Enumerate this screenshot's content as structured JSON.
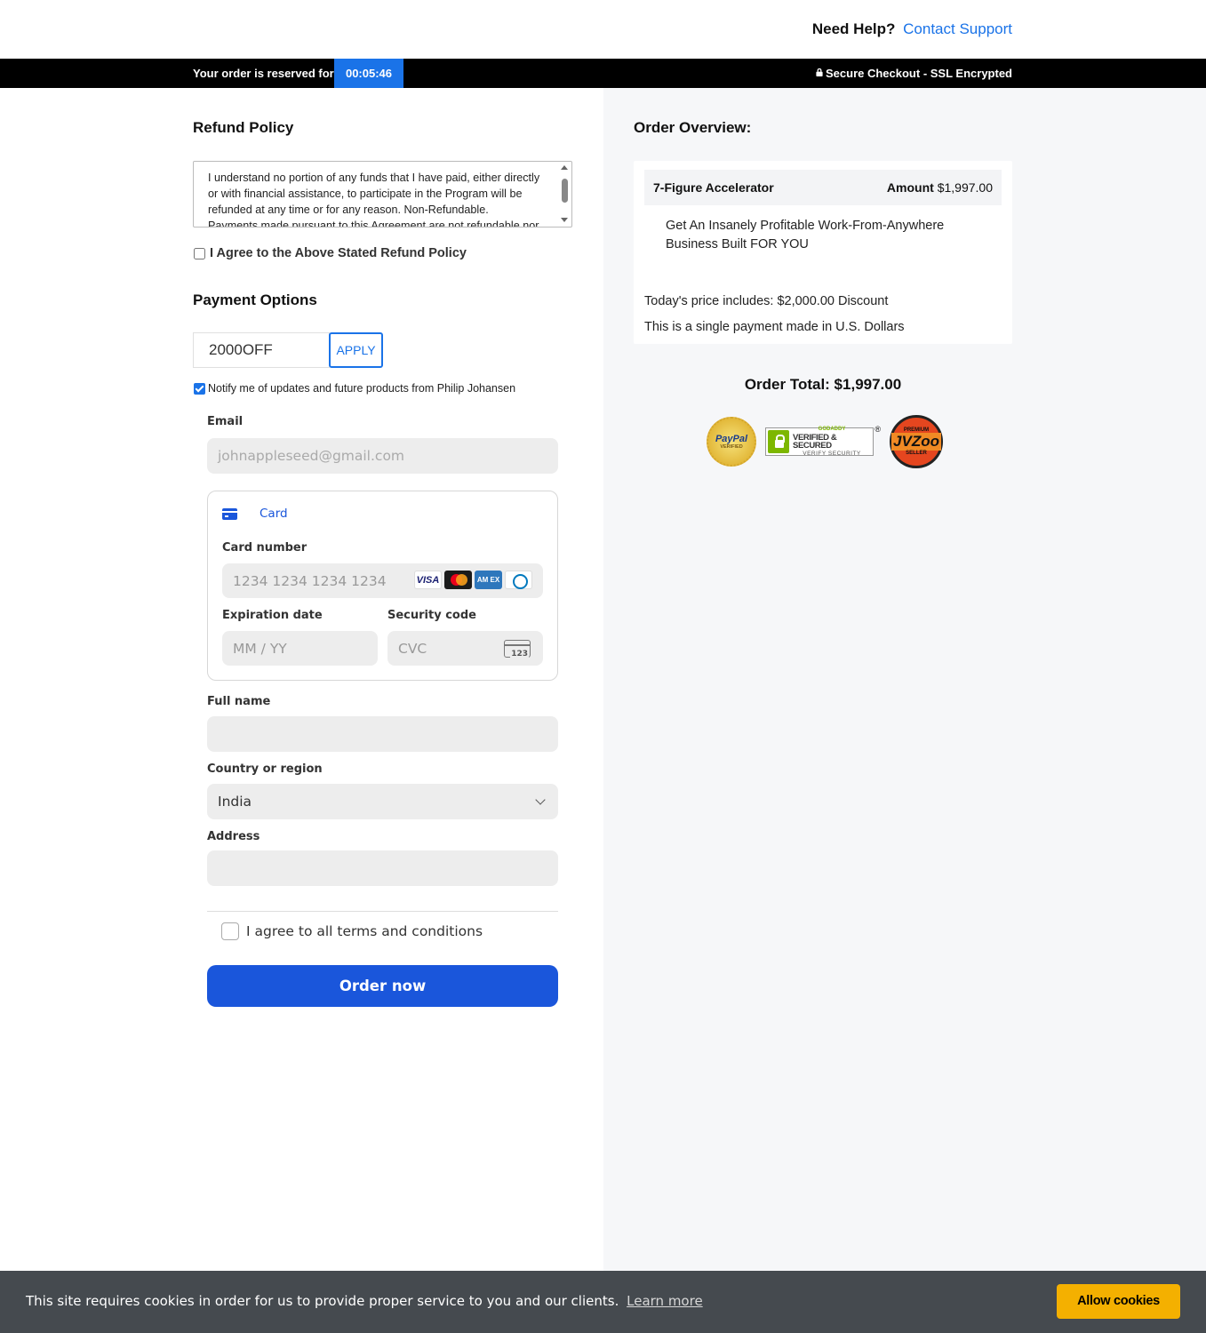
{
  "header": {
    "help_label": "Need Help?",
    "support_link": "Contact Support"
  },
  "banner": {
    "reserve_label": "Your order is reserved for",
    "timer": "00:05:46",
    "secure_label": "Secure Checkout - SSL Encrypted"
  },
  "refund": {
    "title": "Refund Policy",
    "text": "I understand no portion of any funds that I have paid, either directly or with financial assistance, to participate in the Program will be refunded at any time or for any reason. Non-Refundable. Payments made pursuant to this Agreement are not refundable nor",
    "agree_label": "I Agree to the Above Stated Refund Policy"
  },
  "payment": {
    "title": "Payment Options",
    "coupon_value": "2000OFF",
    "apply_label": "APPLY",
    "notify_label": "Notify me of updates and future products from Philip Johansen",
    "notify_checked": true,
    "email_label": "Email",
    "email_placeholder": "johnappleseed@gmail.com",
    "card_tab_label": "Card",
    "card_number_label": "Card number",
    "card_number_placeholder": "1234 1234 1234 1234",
    "card_brands": [
      "VISA",
      "Mastercard",
      "AMEX",
      "Diners"
    ],
    "visa_text": "VISA",
    "amex_text": "AM EX",
    "expiry_label": "Expiration date",
    "expiry_placeholder": "MM / YY",
    "cvc_label": "Security code",
    "cvc_placeholder": "CVC",
    "cvc_icon_text": "123",
    "fullname_label": "Full name",
    "country_label": "Country or region",
    "country_value": "India",
    "address_label": "Address",
    "terms_label": "I agree to all terms and conditions",
    "order_button": "Order now"
  },
  "overview": {
    "title": "Order Overview:",
    "product_name": "7-Figure Accelerator",
    "amount_label": "Amount",
    "amount_value": "$1,997.00",
    "description": "Get An Insanely Profitable Work-From-Anywhere Business Built FOR YOU",
    "discount_line": "Today's price includes: $2,000.00 Discount",
    "currency_line": "This is a single payment made in U.S. Dollars",
    "order_total": "Order Total: $1,997.00"
  },
  "seals": {
    "paypal_text": "PayPal",
    "paypal_sub": "VERIFIED",
    "godaddy_top": "GODADDY",
    "godaddy_main": "VERIFIED & SECURED",
    "godaddy_sub": "VERIFY SECURITY",
    "godaddy_reg": "®",
    "jv_top": "PREMIUM",
    "jv_main": "JVZoo",
    "jv_bottom": "SELLER"
  },
  "cookie": {
    "message": "This site requires cookies in order for us to provide proper service to you and our clients.",
    "learn_more": "Learn more",
    "allow_button": "Allow cookies"
  },
  "colors": {
    "accent_blue": "#1a73e8",
    "order_button": "#1a56db",
    "cookie_button": "#f4b000",
    "cookie_bar": "#454a4f",
    "right_panel": "#f6f7f9"
  }
}
